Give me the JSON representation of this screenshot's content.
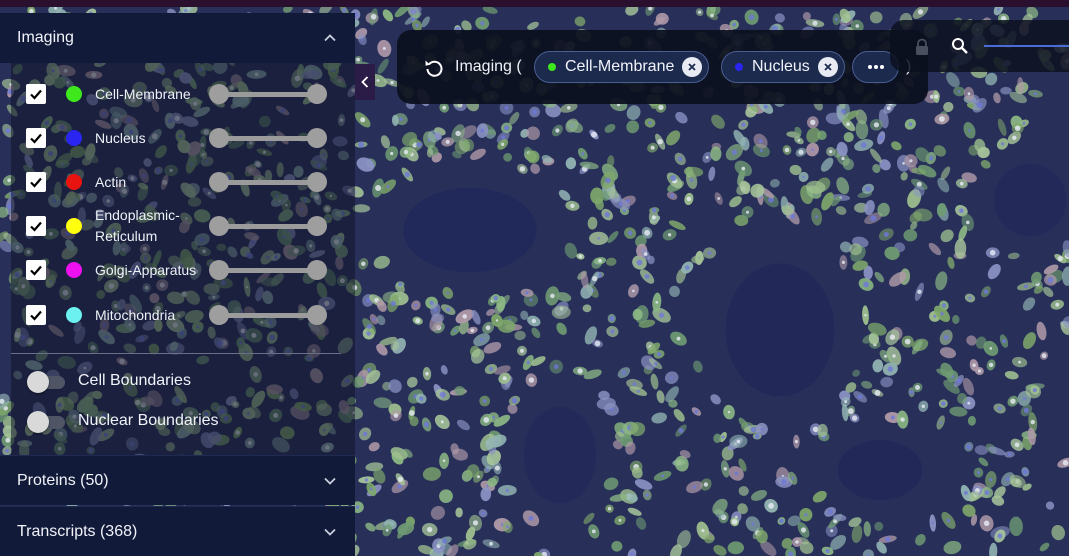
{
  "sidebar": {
    "imaging": {
      "title": "Imaging",
      "channels": [
        {
          "label": "Cell-Membrane",
          "color": "#3ee81d",
          "checked": true,
          "range": [
            0,
            1
          ]
        },
        {
          "label": "Nucleus",
          "color": "#2a25f0",
          "checked": true,
          "range": [
            0,
            1
          ]
        },
        {
          "label": "Actin",
          "color": "#e8140f",
          "checked": true,
          "range": [
            0,
            1
          ]
        },
        {
          "label": "Endoplasmic-Reticulum",
          "color": "#ffff0e",
          "checked": true,
          "range": [
            0,
            1
          ]
        },
        {
          "label": "Golgi-Apparatus",
          "color": "#ee10ee",
          "checked": true,
          "range": [
            0,
            1
          ]
        },
        {
          "label": "Mitochondria",
          "color": "#6cf0f0",
          "checked": true,
          "range": [
            0,
            1
          ]
        }
      ],
      "toggles": [
        {
          "label": "Cell Boundaries",
          "on": false
        },
        {
          "label": "Nuclear Boundaries",
          "on": false
        }
      ]
    },
    "proteins": {
      "title": "Proteins (50)"
    },
    "transcripts": {
      "title": "Transcripts (368)"
    }
  },
  "imaging_bar": {
    "prefix": "Imaging (",
    "chips": [
      {
        "label": "Cell-Membrane",
        "color": "#3ee81d"
      },
      {
        "label": "Nucleus",
        "color": "#2a25f0"
      }
    ],
    "suffix": ")"
  },
  "icons": {
    "reset": "reset-icon",
    "lock": "lock-icon",
    "zoom": "zoom-icon",
    "more": "more-horizontal-icon"
  }
}
